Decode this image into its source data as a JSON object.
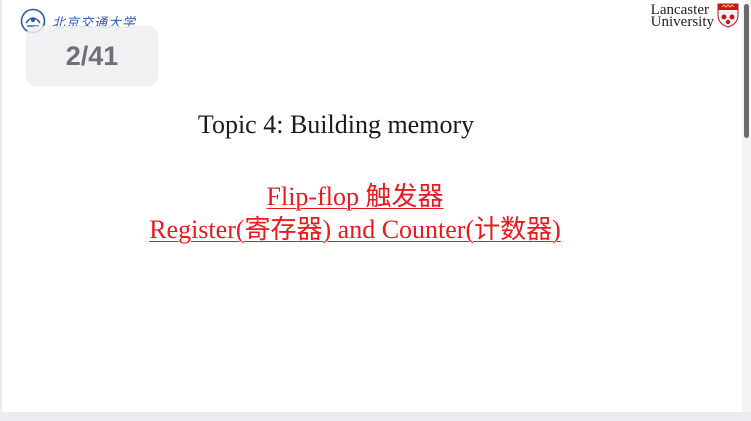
{
  "slide": {
    "page_counter": "2/41",
    "logo_left_text": "北京交通大学",
    "logo_right_line1": "Lancaster",
    "logo_right_line2": "University",
    "title": "Topic 4: Building memory",
    "subtitle_line1": "Flip-flop 触发器",
    "subtitle_line2": "Register(寄存器) and Counter(计数器)"
  },
  "colors": {
    "title": "#1a1a1a",
    "subtitle": "#e8191f",
    "badge_text": "#6f6f74",
    "logo_blue": "#2b5aa8"
  },
  "icons": {
    "left_logo": "university-emblem-icon",
    "right_logo": "lancaster-crest-icon"
  }
}
